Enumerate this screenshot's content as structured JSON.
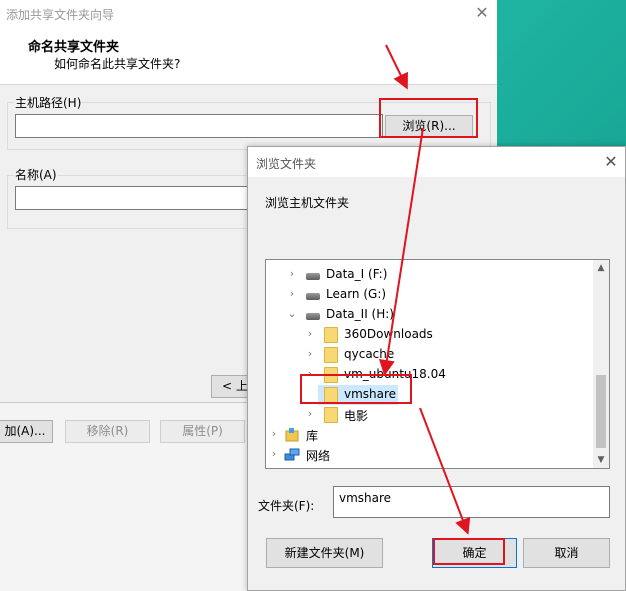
{
  "wizard": {
    "title": "添加共享文件夹向导",
    "heading": "命名共享文件夹",
    "subheading": "如何命名此共享文件夹?",
    "host_path_label": "主机路径(H)",
    "host_path_value": "",
    "browse_label": "浏览(R)...",
    "name_label": "名称(A)",
    "name_value": "",
    "back_label": "< 上",
    "add_label": "加(A)...",
    "remove_label": "移除(R)",
    "properties_label": "属性(P)"
  },
  "browse_dialog": {
    "title": "浏览文件夹",
    "description": "浏览主机文件夹",
    "tree": [
      {
        "label": "Data_I (F:)",
        "icon": "drive-icon",
        "expander": "›"
      },
      {
        "label": "Learn (G:)",
        "icon": "drive-icon",
        "expander": "›"
      },
      {
        "label": "Data_II (H:)",
        "icon": "drive-icon",
        "expander": "⌄"
      },
      {
        "label": "360Downloads",
        "icon": "folder-icon",
        "expander": "›"
      },
      {
        "label": "qycache",
        "icon": "folder-icon",
        "expander": "›"
      },
      {
        "label": "vm_ubuntu18.04",
        "icon": "folder-icon",
        "expander": "›"
      },
      {
        "label": "vmshare",
        "icon": "folder-icon",
        "expander": "",
        "selected": true
      },
      {
        "label": "电影",
        "icon": "folder-icon",
        "expander": "›"
      },
      {
        "label": "库",
        "icon": "library-icon",
        "expander": "›"
      },
      {
        "label": "网络",
        "icon": "network-icon",
        "expander": "›"
      }
    ],
    "folder_label": "文件夹(F):",
    "folder_value": "vmshare",
    "new_folder_label": "新建文件夹(M)",
    "ok_label": "确定",
    "cancel_label": "取消"
  },
  "colors": {
    "highlight": "#e0141e",
    "selection": "#cce8ff"
  }
}
